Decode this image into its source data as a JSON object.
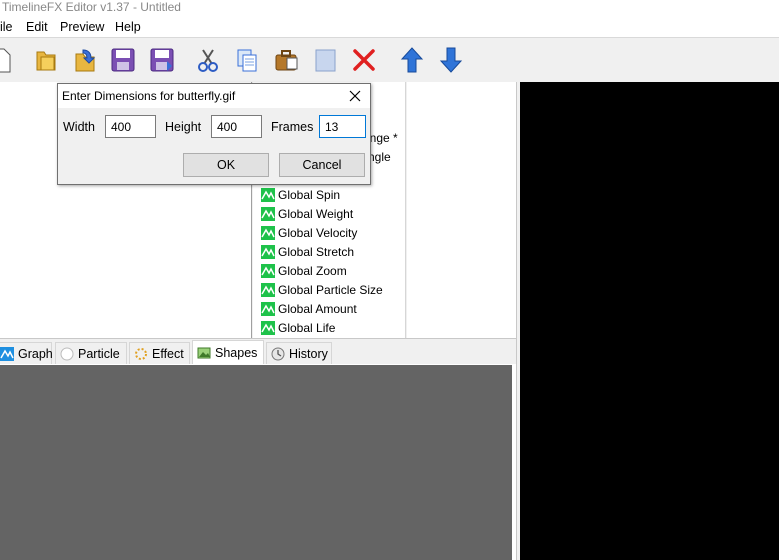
{
  "window": {
    "title": "TimelineFX Editor v1.37 - Untitled"
  },
  "menu": {
    "file": "ile",
    "edit": "Edit",
    "preview": "Preview",
    "help": "Help"
  },
  "attributes": {
    "partial_1": "ange *",
    "partial_2": "ngle",
    "items": [
      {
        "label": "Global Spin"
      },
      {
        "label": "Global Weight"
      },
      {
        "label": "Global Velocity"
      },
      {
        "label": "Global Stretch"
      },
      {
        "label": "Global Zoom"
      },
      {
        "label": "Global Particle Size"
      },
      {
        "label": "Global Amount"
      },
      {
        "label": "Global Life"
      }
    ]
  },
  "tabs": [
    {
      "label": "Graph",
      "icon": "graph-icon"
    },
    {
      "label": "Particle",
      "icon": "particle-icon"
    },
    {
      "label": "Effect",
      "icon": "effect-icon"
    },
    {
      "label": "Shapes",
      "icon": "shapes-icon"
    },
    {
      "label": "History",
      "icon": "history-icon"
    }
  ],
  "dialog": {
    "title": "Enter Dimensions for butterfly.gif",
    "width_label": "Width",
    "width_value": "400",
    "height_label": "Height",
    "height_value": "400",
    "frames_label": "Frames",
    "frames_value": "13",
    "ok": "OK",
    "cancel": "Cancel"
  }
}
